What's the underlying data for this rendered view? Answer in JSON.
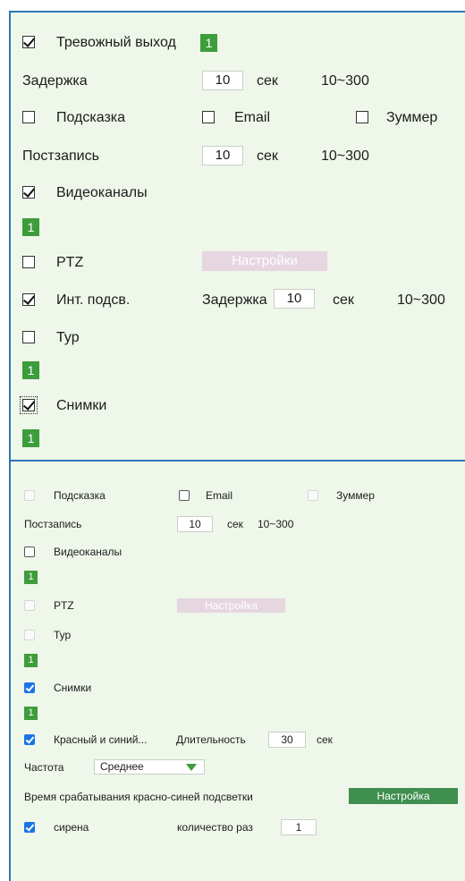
{
  "panel1": {
    "alarm_output": {
      "label": "Тревожный выход",
      "checked": true,
      "channel": "1"
    },
    "delay": {
      "label": "Задержка",
      "value": "10",
      "unit": "сек",
      "range": "10~300"
    },
    "hint": {
      "label": "Подсказка",
      "checked": false
    },
    "email": {
      "label": "Email",
      "checked": false
    },
    "buzzer": {
      "label": "Зуммер",
      "checked": false
    },
    "post_record": {
      "label": "Постзапись",
      "value": "10",
      "unit": "сек",
      "range": "10~300"
    },
    "video_channels": {
      "label": "Видеоканалы",
      "checked": true,
      "channel": "1"
    },
    "ptz": {
      "label": "PTZ",
      "checked": false
    },
    "settings_button": "Настройки",
    "ir_light": {
      "label": "Инт. подсв.",
      "checked": true,
      "delay_label": "Задержка",
      "value": "10",
      "unit": "сек",
      "range": "10~300"
    },
    "tour": {
      "label": "Тур",
      "checked": false,
      "channel": "1"
    },
    "snapshots": {
      "label": "Снимки",
      "checked": true,
      "channel": "1"
    }
  },
  "panel2": {
    "hint": {
      "label": "Подсказка",
      "checked": false
    },
    "email": {
      "label": "Email",
      "checked": false
    },
    "buzzer": {
      "label": "Зуммер",
      "checked": false
    },
    "post_record": {
      "label": "Постзапись",
      "value": "10",
      "unit": "сек",
      "range": "10~300"
    },
    "video_channels": {
      "label": "Видеоканалы",
      "checked": false,
      "channel": "1"
    },
    "ptz": {
      "label": "PTZ",
      "checked": false
    },
    "settings_button": "Настройка",
    "tour": {
      "label": "Тур",
      "checked": false,
      "channel": "1"
    },
    "snapshots": {
      "label": "Снимки",
      "checked": true,
      "channel": "1"
    },
    "red_blue": {
      "label": "Красный и синий...",
      "duration_label": "Длительность",
      "value": "30",
      "unit": "сек",
      "checked": true
    },
    "frequency": {
      "label": "Частота",
      "selected": "Среднее"
    },
    "red_blue_time": {
      "label": "Время срабатывания красно-синей подсветки",
      "button": "Настройка"
    },
    "siren": {
      "label": "сирена",
      "checked": true,
      "count_label": "количество раз",
      "count_value": "1"
    }
  },
  "colors": {
    "panel_bg": "#eef7ea",
    "accent_green": "#3d9d3b",
    "checkbox_blue": "#1a73e8",
    "border_blue": "#2e75b6",
    "disabled_button": "#e6d6e0"
  }
}
